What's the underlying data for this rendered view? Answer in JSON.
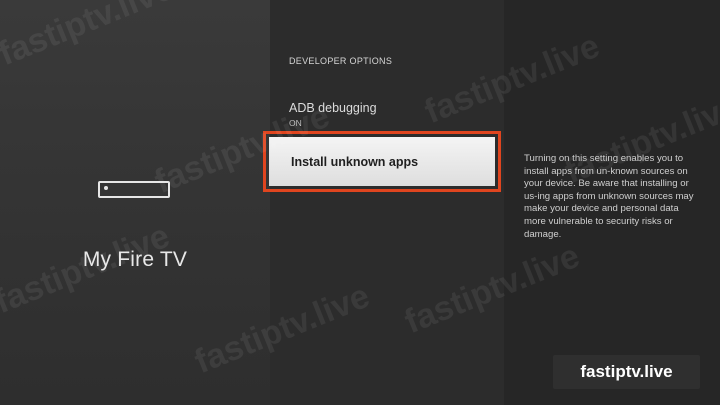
{
  "device": {
    "title": "My Fire TV",
    "icon": "fire-tv-device-icon"
  },
  "developer_options": {
    "heading": "DEVELOPER OPTIONS",
    "items": [
      {
        "label": "ADB debugging",
        "value": "ON"
      },
      {
        "label": "Install unknown apps",
        "selected": true
      }
    ]
  },
  "description": "Turning on this setting enables you to install apps from un-known sources on your device. Be aware that installing or us-ing apps from unknown sources may make your device and personal data more vulnerable to security risks or damage.",
  "watermark": {
    "text": "fastiptv.live"
  },
  "brand": {
    "text": "fastiptv.live"
  },
  "colors": {
    "highlight_border": "#e0451f",
    "selected_background": "#ececec"
  }
}
